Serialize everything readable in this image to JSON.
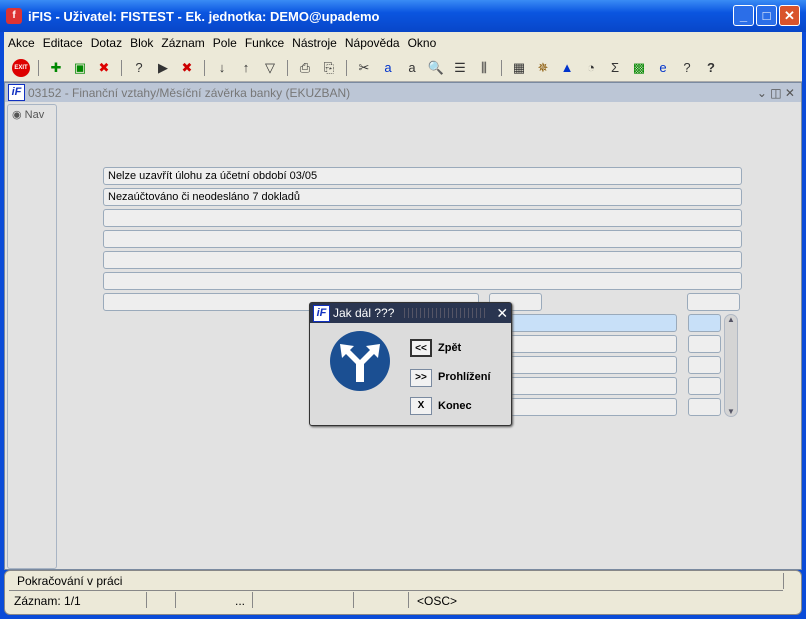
{
  "window": {
    "title": "iFIS - Uživatel: FISTEST - Ek. jednotka: DEMO@upademo"
  },
  "menu": [
    "Akce",
    "Editace",
    "Dotaz",
    "Blok",
    "Záznam",
    "Pole",
    "Funkce",
    "Nástroje",
    "Nápověda",
    "Okno"
  ],
  "toolbar": {
    "exit": "EXIT"
  },
  "form": {
    "title": "03152 - Finanční vztahy/Měsíční závěrka banky (EKUZBAN)",
    "nav": "Nav",
    "fields": [
      "Nelze uzavřít úlohu za účetní období 03/05",
      "Nezaúčtováno či neodesláno 7 dokladů"
    ]
  },
  "dialog": {
    "title": "Jak dál ???",
    "buttons": [
      {
        "key": "<<",
        "label": "Zpět"
      },
      {
        "key": ">>",
        "label": "Prohlížení"
      },
      {
        "key": "X",
        "label": "Konec"
      }
    ]
  },
  "status": {
    "message": "Pokračování v práci",
    "record": "Záznam: 1/1",
    "dots": "...",
    "mode": "<OSC>"
  }
}
